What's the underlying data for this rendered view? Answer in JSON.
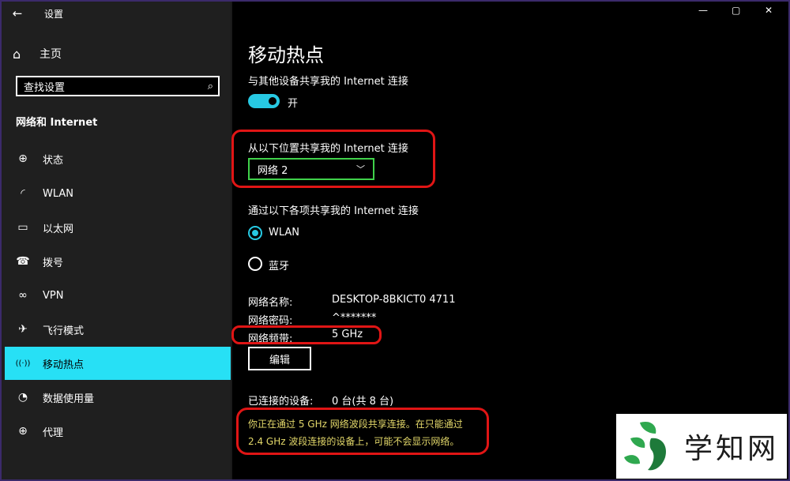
{
  "window": {
    "title": "设置",
    "controls": {
      "minimize": "—",
      "maximize": "▢",
      "close": "✕"
    }
  },
  "sidebar": {
    "home": "主页",
    "search_text": "查找设置",
    "section_title": "网络和 Internet",
    "items": [
      {
        "label": "状态",
        "icon": "globe-icon",
        "glyph": "⊕"
      },
      {
        "label": "WLAN",
        "icon": "wifi-icon",
        "glyph": "◜"
      },
      {
        "label": "以太网",
        "icon": "ethernet-icon",
        "glyph": "▭"
      },
      {
        "label": "拨号",
        "icon": "dialup-icon",
        "glyph": "☎"
      },
      {
        "label": "VPN",
        "icon": "vpn-icon",
        "glyph": "∞"
      },
      {
        "label": "飞行模式",
        "icon": "airplane-icon",
        "glyph": "✈"
      },
      {
        "label": "移动热点",
        "icon": "hotspot-icon",
        "glyph": "((·))"
      },
      {
        "label": "数据使用量",
        "icon": "data-usage-icon",
        "glyph": "◔"
      },
      {
        "label": "代理",
        "icon": "proxy-icon",
        "glyph": "⊕"
      }
    ],
    "active_index": 6,
    "accent": "#27e0f5"
  },
  "main": {
    "title": "移动热点",
    "share_label": "与其他设备共享我的 Internet 连接",
    "toggle_state": "开",
    "share_from_label": "从以下位置共享我的 Internet 连接",
    "share_from_value": "网络 2",
    "share_over_label": "通过以下各项共享我的 Internet 连接",
    "radio_wlan": "WLAN",
    "radio_bt": "蓝牙",
    "network_name_label": "网络名称:",
    "network_name_value": "DESKTOP-8BKICT0 4711",
    "network_password_label": "网络密码:",
    "network_password_value": "^*******",
    "network_band_label": "网络频带:",
    "network_band_value": "5 GHz",
    "edit_button": "编辑",
    "devices_label": "已连接的设备:",
    "devices_value": "0 台(共 8 台)",
    "warning_line1": "你正在通过 5 GHz 网络波段共享连接。在只能通过",
    "warning_line2": "2.4 GHz 波段连接的设备上，可能不会显示网络。"
  },
  "watermark": {
    "text": "学知网"
  }
}
